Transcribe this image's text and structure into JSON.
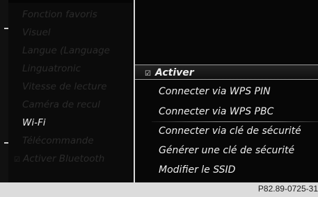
{
  "left_menu": {
    "items": [
      {
        "label": "Fonction favoris",
        "state": "dim"
      },
      {
        "label": "Visuel",
        "state": "dim"
      },
      {
        "label": "Langue (Language",
        "state": "dim"
      },
      {
        "label": "Linguatronic",
        "state": "dim"
      },
      {
        "label": "Vitesse de lecture",
        "state": "dim"
      },
      {
        "label": "Caméra de recul",
        "state": "dim"
      },
      {
        "label": "Wi-Fi",
        "state": "active"
      },
      {
        "label": "Télécommande",
        "state": "dim"
      },
      {
        "label": "Activer Bluetooth",
        "state": "dim",
        "checked": true
      }
    ]
  },
  "right_menu": {
    "items": [
      {
        "label": "Activer",
        "selected": true,
        "checked": true
      },
      {
        "label": "Connecter via WPS PIN"
      },
      {
        "label": "Connecter via WPS PBC"
      },
      {
        "label": "Connecter via clé de sécurité"
      },
      {
        "label": "Générer une clé de sécurité"
      },
      {
        "label": "Modifier le SSID"
      }
    ]
  },
  "check_glyph": "☑",
  "footer": {
    "reference": "P82.89-0725-31"
  },
  "colors": {
    "active_text": "#e8e8e8",
    "dim_text": "#2b2b2b",
    "footer_bg": "#dcdcdc"
  }
}
